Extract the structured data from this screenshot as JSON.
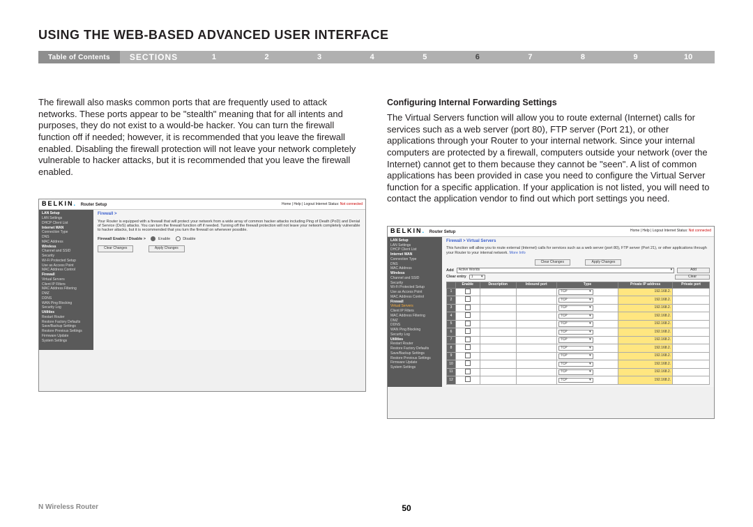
{
  "page_title": "USING THE WEB-BASED ADVANCED USER INTERFACE",
  "nav": {
    "toc": "Table of Contents",
    "sections_label": "SECTIONS",
    "numbers": [
      "1",
      "2",
      "3",
      "4",
      "5",
      "6",
      "7",
      "8",
      "9",
      "10"
    ],
    "active_index": 5
  },
  "left_col": {
    "body": "The firewall also masks common ports that are frequently used to attack networks. These ports appear to be \"stealth\" meaning that for all intents and purposes, they do not exist to a would-be hacker. You can turn the firewall function off if needed; however, it is recommended that you leave the firewall enabled. Disabling the firewall protection will not leave your network completely vulnerable to hacker attacks, but it is recommended that you leave the firewall enabled."
  },
  "right_col": {
    "heading": "Configuring Internal Forwarding Settings",
    "body": "The Virtual Servers function will allow you to route external (Internet) calls for services such as a web server (port 80), FTP server (Port 21), or other applications through your Router to your internal network. Since your internal computers are protected by a firewall, computers outside your network (over the Internet) cannot get to them because they cannot be \"seen\". A list of common applications has been provided in case you need to configure the Virtual Server function for a specific application. If your application is not listed, you will need to contact the application vendor to find out which port settings you need."
  },
  "belkin": {
    "logo": "BELKIN",
    "router_setup": "Router Setup",
    "top_links": "Home | Help | Logout   Internet Status:",
    "not_connected": "Not connected",
    "side_items": [
      {
        "t": "LAN Setup",
        "b": true
      },
      {
        "t": "LAN Settings"
      },
      {
        "t": "DHCP Client List"
      },
      {
        "t": "Internet WAN",
        "b": true
      },
      {
        "t": "Connection Type"
      },
      {
        "t": "DNS"
      },
      {
        "t": "MAC Address"
      },
      {
        "t": "Wireless",
        "b": true
      },
      {
        "t": "Channel and SSID"
      },
      {
        "t": "Security"
      },
      {
        "t": "Wi-Fi Protected Setup"
      },
      {
        "t": "Use as Access Point"
      },
      {
        "t": "MAC Address Control"
      },
      {
        "t": "Firewall",
        "b": true,
        "active_fw": true
      },
      {
        "t": "Virtual Servers",
        "active_vs": true
      },
      {
        "t": "Client IP Filters"
      },
      {
        "t": "MAC Address Filtering"
      },
      {
        "t": "DMZ"
      },
      {
        "t": "DDNS"
      },
      {
        "t": "WAN Ping Blocking"
      },
      {
        "t": "Security Log"
      },
      {
        "t": "Utilities",
        "b": true
      },
      {
        "t": "Restart Router"
      },
      {
        "t": "Restore Factory Defaults"
      },
      {
        "t": "Save/Backup Settings"
      },
      {
        "t": "Restore Previous Settings"
      },
      {
        "t": "Firmware Update"
      },
      {
        "t": "System Settings"
      }
    ]
  },
  "firewall_panel": {
    "crumb": "Firewall >",
    "desc": "Your Router is equipped with a firewall that will protect your network from a wide array of common hacker attacks including Ping of Death (PoD) and Denial of Service (DoS) attacks. You can turn the firewall function off if needed. Turning off the firewall protection will not leave your network completely vulnerable to hacker attacks, but it is recommended that you turn the firewall on whenever possible.",
    "enable_label": "Firewall Enable / Disable >",
    "opt_enable": "Enable",
    "opt_disable": "Disable",
    "btn_clear": "Clear Changes",
    "btn_apply": "Apply Changes"
  },
  "vs_panel": {
    "crumb": "Firewall > Virtual Servers",
    "desc": "This function will allow you to route external (Internet) calls for services such as a web server (port 80), FTP server (Port 21), or other applications through your Router to your internal network.",
    "more_info": "More Info",
    "btn_clear": "Clear Changes",
    "btn_apply": "Apply Changes",
    "add_label": "Add",
    "add_value": "Active Worlds",
    "btn_add": "Add",
    "clear_entry_label": "Clear entry",
    "clear_entry_value": "1",
    "btn_clear2": "Clear",
    "headers": [
      "Enable",
      "Description",
      "Inbound port",
      "Type",
      "Private IP address",
      "Private port"
    ],
    "type_val": "TCP",
    "ip_val": "192.168.2.",
    "row_count": 12
  },
  "footer": {
    "left": "N Wireless Router",
    "page": "50"
  }
}
